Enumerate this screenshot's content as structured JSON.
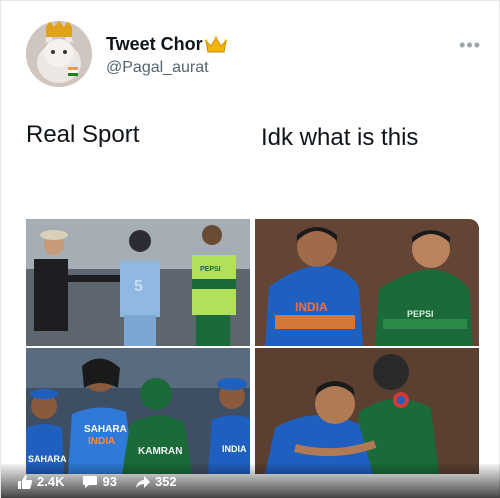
{
  "tweet": {
    "display_name": "Tweet Chor",
    "handle": "@Pagal_aurat",
    "more_label": "•••"
  },
  "captions": {
    "left": "Real Sport",
    "right": "Idk what is this"
  },
  "images": {
    "top_left": {
      "jersey_text": "PEPSI"
    },
    "top_right": {
      "jersey_text": "INDIA",
      "jersey_text_2": "PEPSI"
    },
    "bottom_left": {
      "jersey_text": "SAHARA",
      "jersey_text_2": "INDIA",
      "jersey_text_3": "KAMRAN",
      "jersey_text_4": "SAHARA",
      "jersey_text_5": "INDIA"
    }
  },
  "stats": {
    "likes": "2.4K",
    "comments": "93",
    "shares": "352"
  },
  "colors": {
    "india_blue": "#1f5fbf",
    "pakistan_green": "#1b6b3a",
    "handle_grey": "#536471"
  }
}
